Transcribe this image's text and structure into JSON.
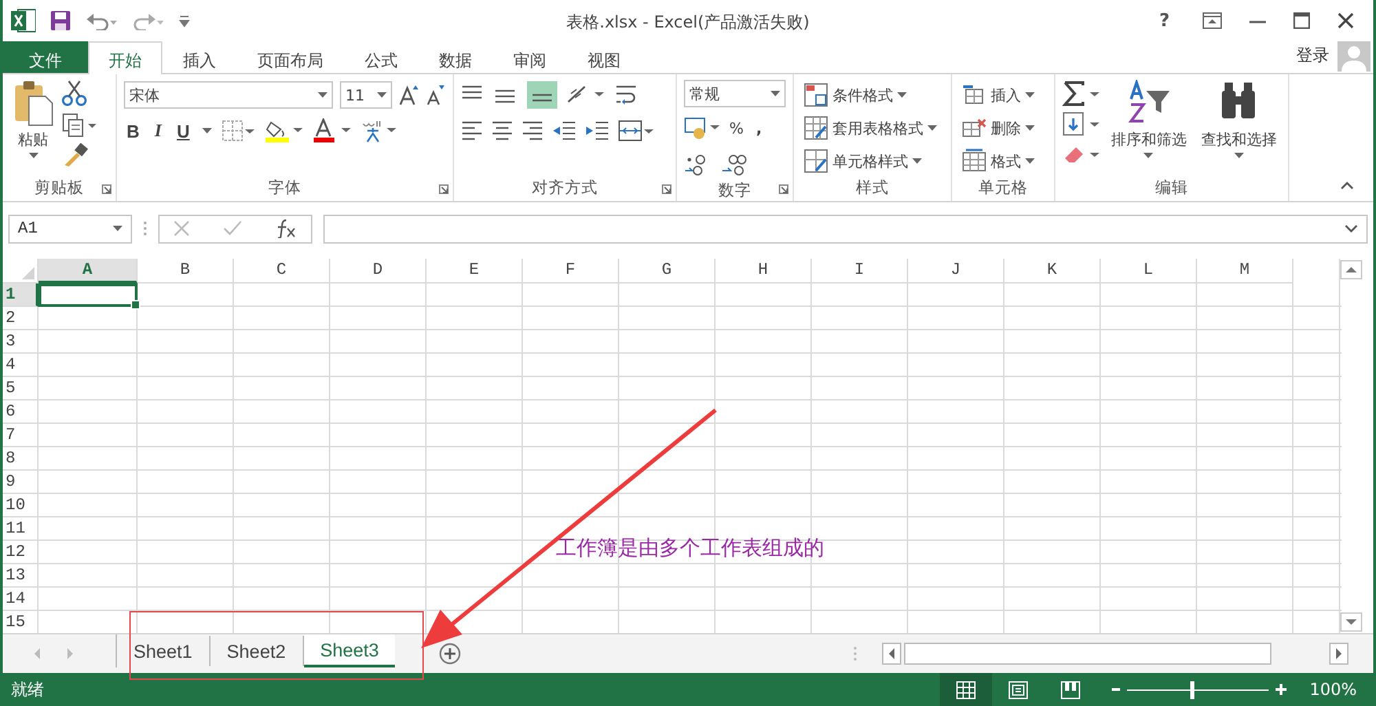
{
  "window": {
    "title": "表格.xlsx - Excel(产品激活失败)",
    "help": "?"
  },
  "menu_tabs": [
    {
      "label": "文件",
      "kind": "file",
      "selected": false
    },
    {
      "label": "开始",
      "kind": "tab",
      "selected": true
    },
    {
      "label": "插入",
      "kind": "tab",
      "selected": false
    },
    {
      "label": "页面布局",
      "kind": "tab",
      "selected": false
    },
    {
      "label": "公式",
      "kind": "tab",
      "selected": false
    },
    {
      "label": "数据",
      "kind": "tab",
      "selected": false
    },
    {
      "label": "审阅",
      "kind": "tab",
      "selected": false
    },
    {
      "label": "视图",
      "kind": "tab",
      "selected": false
    }
  ],
  "account": {
    "label": "登录"
  },
  "ribbon": {
    "clipboard": {
      "title": "剪贴板",
      "paste": "粘贴"
    },
    "font": {
      "title": "字体",
      "font_name": "宋体",
      "font_size": "11",
      "bold": "B",
      "italic": "I",
      "underline": "U"
    },
    "alignment": {
      "title": "对齐方式"
    },
    "number": {
      "title": "数字",
      "format": "常规",
      "percent": "%",
      "comma": ","
    },
    "styles": {
      "title": "样式",
      "items": [
        "条件格式",
        "套用表格格式",
        "单元格样式"
      ]
    },
    "cells": {
      "title": "单元格",
      "items": [
        "插入",
        "删除",
        "格式"
      ]
    },
    "editing": {
      "title": "编辑",
      "items": [
        "排序和筛选",
        "查找和选择"
      ]
    }
  },
  "formula_bar": {
    "name_box": "A1"
  },
  "columns": [
    {
      "label": "A",
      "selected": true
    },
    {
      "label": "B",
      "selected": false
    },
    {
      "label": "C",
      "selected": false
    },
    {
      "label": "D",
      "selected": false
    },
    {
      "label": "E",
      "selected": false
    },
    {
      "label": "F",
      "selected": false
    },
    {
      "label": "G",
      "selected": false
    },
    {
      "label": "H",
      "selected": false
    },
    {
      "label": "I",
      "selected": false
    },
    {
      "label": "J",
      "selected": false
    },
    {
      "label": "K",
      "selected": false
    },
    {
      "label": "L",
      "selected": false
    },
    {
      "label": "M",
      "selected": false
    }
  ],
  "rows": [
    {
      "label": "1",
      "selected": true
    },
    {
      "label": "2",
      "selected": false
    },
    {
      "label": "3",
      "selected": false
    },
    {
      "label": "4",
      "selected": false
    },
    {
      "label": "5",
      "selected": false
    },
    {
      "label": "6",
      "selected": false
    },
    {
      "label": "7",
      "selected": false
    },
    {
      "label": "8",
      "selected": false
    },
    {
      "label": "9",
      "selected": false
    },
    {
      "label": "10",
      "selected": false
    },
    {
      "label": "11",
      "selected": false
    },
    {
      "label": "12",
      "selected": false
    },
    {
      "label": "13",
      "selected": false
    },
    {
      "label": "14",
      "selected": false
    },
    {
      "label": "15",
      "selected": false
    }
  ],
  "sheets": [
    {
      "label": "Sheet1",
      "selected": false
    },
    {
      "label": "Sheet2",
      "selected": false
    },
    {
      "label": "Sheet3",
      "selected": true
    }
  ],
  "status_bar": {
    "status": "就绪",
    "zoom": "100%",
    "zoom_slider": {
      "level": 0.46
    },
    "views": [
      {
        "kind": "normal",
        "selected": true
      },
      {
        "kind": "page_layout",
        "selected": false
      },
      {
        "kind": "page_break",
        "selected": false
      }
    ]
  },
  "annotation": {
    "text": "工作簿是由多个工作表组成的"
  }
}
